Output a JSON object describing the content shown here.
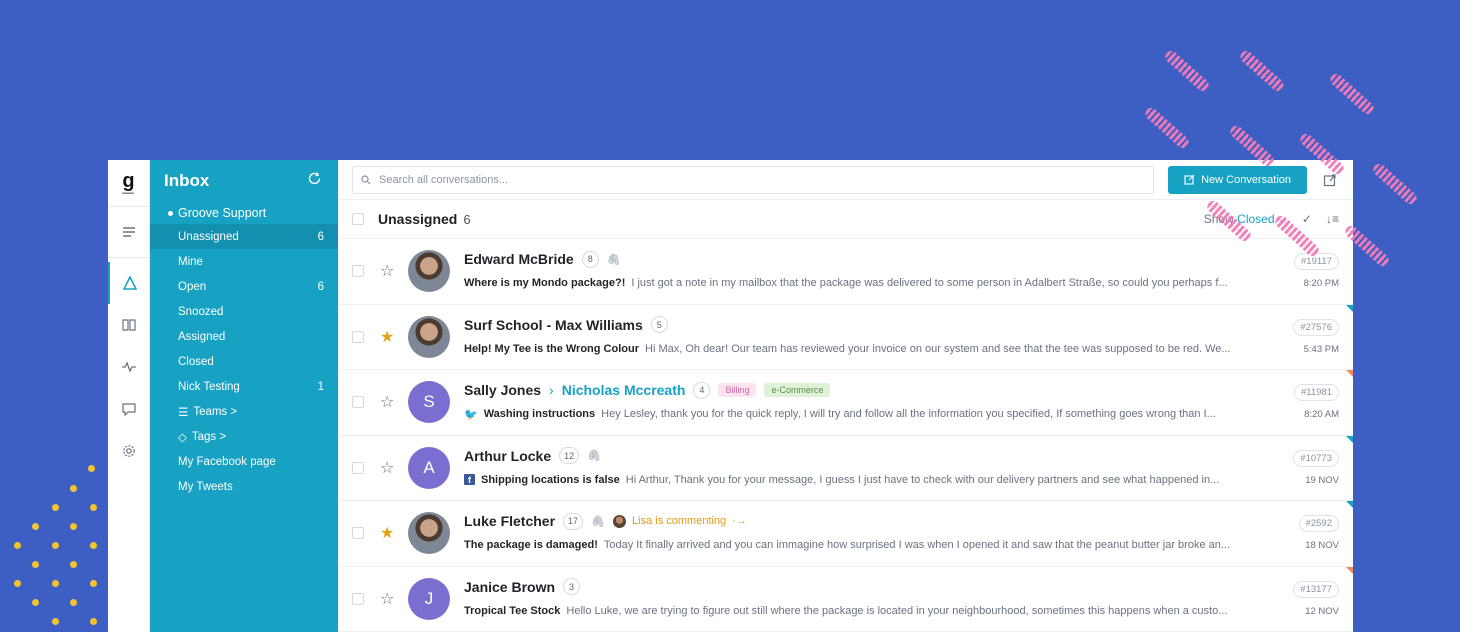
{
  "sidebar": {
    "title": "Inbox",
    "account": "Groove Support",
    "folders": [
      {
        "label": "Unassigned",
        "count": "6"
      },
      {
        "label": "Mine",
        "count": ""
      },
      {
        "label": "Open",
        "count": "6"
      },
      {
        "label": "Snoozed",
        "count": ""
      },
      {
        "label": "Assigned",
        "count": ""
      },
      {
        "label": "Closed",
        "count": ""
      },
      {
        "label": "Nick Testing",
        "count": "1"
      },
      {
        "label": "Teams >",
        "count": ""
      },
      {
        "label": "Tags >",
        "count": ""
      },
      {
        "label": "My Facebook page",
        "count": ""
      },
      {
        "label": "My Tweets",
        "count": ""
      }
    ]
  },
  "topbar": {
    "search_placeholder": "Search all conversations...",
    "new_conversation": "New Conversation"
  },
  "list": {
    "title": "Unassigned",
    "count": "6",
    "show_label": "Show",
    "show_value": "Closed"
  },
  "conversations": [
    {
      "name": "Edward McBride",
      "count": "8",
      "subject": "Where is my Mondo package?!",
      "preview": "I just got a note in my mailbox that the package was delivered to some person in Adalbert Straße, so could you perhaps f...",
      "id": "#19117",
      "time": "8:20 PM",
      "starred": false
    },
    {
      "name": "Surf School - Max Williams",
      "count": "5",
      "subject": "Help! My Tee is the Wrong Colour",
      "preview": "Hi Max, Oh dear! Our team has reviewed your invoice on our system and see that the tee was supposed to be red. We...",
      "id": "#27576",
      "time": "5:43 PM",
      "starred": true
    },
    {
      "name": "Sally Jones",
      "assignee": "Nicholas Mccreath",
      "count": "4",
      "tags": [
        "Billing",
        "e-Commerce"
      ],
      "subject": "Washing instructions",
      "preview": "Hey Lesley, thank you for the quick reply, I will try and follow all the information you specified, If something goes wrong than I...",
      "id": "#11981",
      "time": "8:20 AM",
      "avatar_letter": "S",
      "starred": false
    },
    {
      "name": "Arthur Locke",
      "count": "12",
      "subject": "Shipping locations is false",
      "preview": "Hi Arthur, Thank you for your message, I guess I just have to check with our delivery partners and see what happened in...",
      "id": "#10773",
      "time": "19 NOV",
      "avatar_letter": "A",
      "starred": false
    },
    {
      "name": "Luke Fletcher",
      "count": "17",
      "commenting": "Lisa is commenting",
      "subject": "The package is damaged!",
      "preview": "Today It finally arrived and you can immagine how surprised I was when I opened it and saw that the peanut butter jar broke an...",
      "id": "#2592",
      "time": "18 NOV",
      "starred": true
    },
    {
      "name": "Janice Brown",
      "count": "3",
      "subject": "Tropical Tee Stock",
      "preview": "Hello Luke, we are trying to figure out still where the package is located in your neighbourhood, sometimes this happens when a custo...",
      "id": "#13177",
      "time": "12 NOV",
      "avatar_letter": "J",
      "starred": false
    }
  ],
  "colors": {
    "brand": "#17a2c4",
    "background": "#3d5fc4",
    "star": "#e0a51b",
    "avatar_letter": "#7a6fd0"
  }
}
